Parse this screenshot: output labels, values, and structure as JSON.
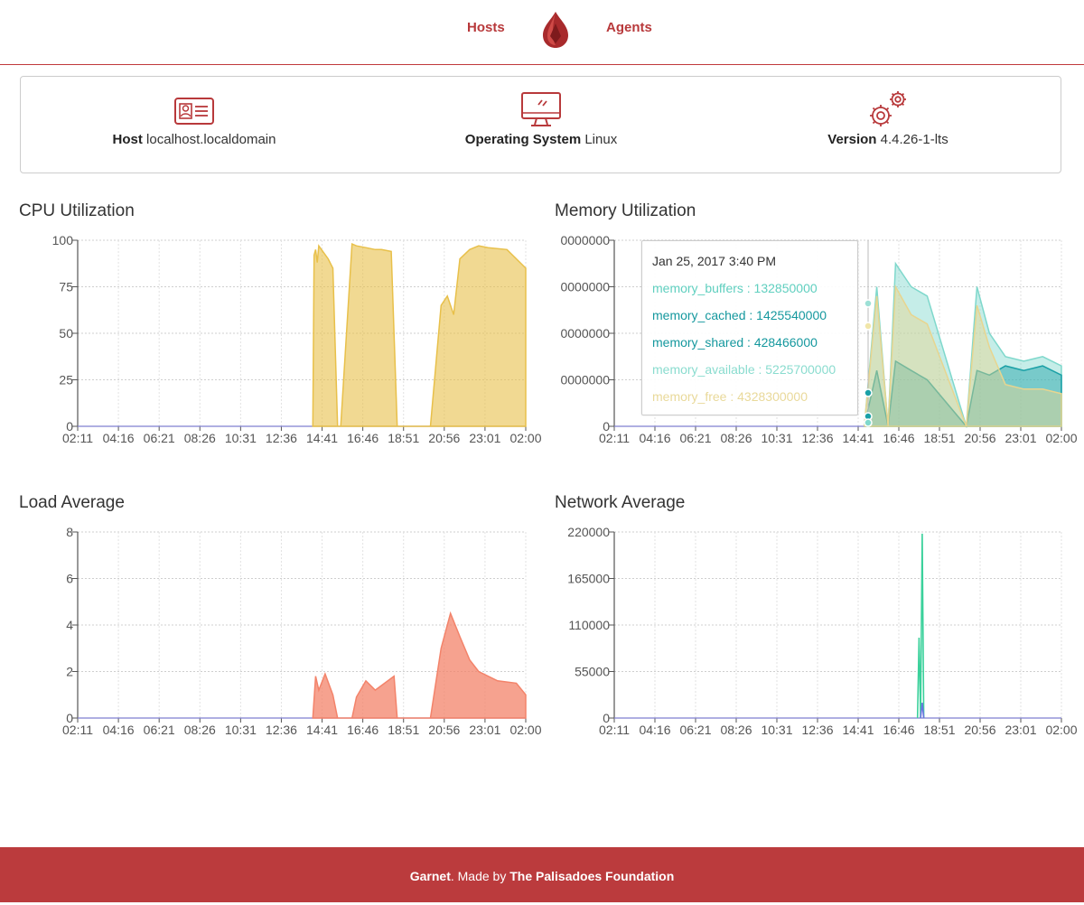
{
  "nav": {
    "hosts_label": "Hosts",
    "agents_label": "Agents",
    "logo_icon": "garnet-logo-icon"
  },
  "info": {
    "host": {
      "label": "Host",
      "value": "localhost.localdomain",
      "icon": "host-id-card-icon"
    },
    "os": {
      "label": "Operating System",
      "value": "Linux",
      "icon": "monitor-icon"
    },
    "version": {
      "label": "Version",
      "value": "4.4.26-1-lts",
      "icon": "gears-icon"
    }
  },
  "colors": {
    "brand": "#bb3b3d",
    "cpu": "#e8c04a",
    "load": "#f3836a",
    "mem_a": "#5ccfc0",
    "mem_b": "#1aa0a6",
    "net": "#3ad19b"
  },
  "chart_data": [
    {
      "type": "area",
      "title": "CPU Utilization",
      "x_ticks": [
        "02:11",
        "04:16",
        "06:21",
        "08:26",
        "10:31",
        "12:36",
        "14:41",
        "16:46",
        "18:51",
        "20:56",
        "23:01",
        "02:00"
      ],
      "y_ticks": [
        "0",
        "25",
        "50",
        "75",
        "100"
      ],
      "ylim": [
        0,
        100
      ],
      "grid": true,
      "series": [
        {
          "color": "#e8c04a",
          "x": [
            "14:41",
            "14:45",
            "14:50",
            "14:55",
            "15:00",
            "15:30",
            "15:45",
            "16:00",
            "16:10",
            "16:46",
            "17:00",
            "17:30",
            "18:00",
            "18:20",
            "18:51",
            "19:10",
            "20:56",
            "21:30",
            "21:50",
            "22:10",
            "22:30",
            "23:01",
            "23:30",
            "00:00",
            "01:00",
            "02:00"
          ],
          "values": [
            0,
            92,
            95,
            88,
            97,
            90,
            85,
            0,
            0,
            98,
            97,
            96,
            95,
            95,
            94,
            0,
            0,
            65,
            70,
            60,
            90,
            95,
            97,
            96,
            95,
            85
          ]
        }
      ]
    },
    {
      "type": "area",
      "title": "Memory Utilization",
      "x_ticks": [
        "02:11",
        "04:16",
        "06:21",
        "08:26",
        "10:31",
        "12:36",
        "14:41",
        "16:46",
        "18:51",
        "20:56",
        "23:01",
        "02:00"
      ],
      "y_ticks": [
        "0",
        "0000000",
        "0000000",
        "0000000",
        "0000000"
      ],
      "grid": true,
      "series": [
        {
          "name": "memory_buffers",
          "color": "#7fd8cc",
          "x": [
            "15:30",
            "16:10",
            "16:46",
            "17:10",
            "18:00",
            "18:51",
            "20:56",
            "21:30",
            "22:10",
            "23:01",
            "00:00",
            "01:00",
            "02:00"
          ],
          "values": [
            0,
            3,
            0,
            3.5,
            3.0,
            2.8,
            0,
            3.0,
            2.0,
            1.5,
            1.4,
            1.5,
            1.3
          ]
        },
        {
          "name": "memory_cached",
          "color": "#1aa0a6",
          "x": [
            "15:30",
            "16:10",
            "16:46",
            "17:10",
            "18:00",
            "18:51",
            "20:56",
            "21:30",
            "22:10",
            "23:01",
            "00:00",
            "01:00",
            "02:00"
          ],
          "values": [
            0,
            1.2,
            0,
            1.4,
            1.2,
            1.0,
            0,
            1.2,
            1.1,
            1.3,
            1.2,
            1.3,
            1.1
          ]
        },
        {
          "name": "memory_free",
          "color": "#e8d58f",
          "x": [
            "15:30",
            "16:10",
            "16:46",
            "17:10",
            "18:00",
            "18:51",
            "20:56",
            "21:30",
            "22:10",
            "23:01",
            "00:00",
            "01:00",
            "02:00"
          ],
          "values": [
            0,
            2.8,
            0,
            3.0,
            2.4,
            2.2,
            0,
            2.6,
            1.7,
            0.9,
            0.8,
            0.8,
            0.7
          ]
        }
      ],
      "tooltip": {
        "title": "Jan 25, 2017 3:40 PM",
        "rows": [
          {
            "label": "memory_buffers : 132850000",
            "color": "#5fcfbf"
          },
          {
            "label": "memory_cached : 1425540000",
            "color": "#15989e"
          },
          {
            "label": "memory_shared : 428466000",
            "color": "#15989e"
          },
          {
            "label": "memory_available : 5225700000",
            "color": "#8adccf"
          },
          {
            "label": "memory_free : 4328300000",
            "color": "#e9d99a"
          }
        ]
      }
    },
    {
      "type": "area",
      "title": "Load Average",
      "x_ticks": [
        "02:11",
        "04:16",
        "06:21",
        "08:26",
        "10:31",
        "12:36",
        "14:41",
        "16:46",
        "18:51",
        "20:56",
        "23:01",
        "02:00"
      ],
      "y_ticks": [
        "0",
        "2",
        "4",
        "6",
        "8"
      ],
      "ylim": [
        0,
        8
      ],
      "grid": true,
      "series": [
        {
          "color": "#f3836a",
          "x": [
            "14:41",
            "14:50",
            "15:00",
            "15:20",
            "15:45",
            "16:00",
            "16:46",
            "17:00",
            "17:30",
            "18:00",
            "18:30",
            "19:00",
            "19:10",
            "20:56",
            "21:30",
            "22:00",
            "22:30",
            "23:01",
            "23:30",
            "00:30",
            "01:30",
            "02:00"
          ],
          "values": [
            0,
            1.8,
            1.2,
            1.9,
            1.0,
            0,
            0,
            0.9,
            1.6,
            1.2,
            1.5,
            1.8,
            0,
            0,
            3.0,
            4.5,
            3.5,
            2.5,
            2.0,
            1.6,
            1.5,
            1.0
          ]
        }
      ]
    },
    {
      "type": "line",
      "title": "Network Average",
      "x_ticks": [
        "02:11",
        "04:16",
        "06:21",
        "08:26",
        "10:31",
        "12:36",
        "14:41",
        "16:46",
        "18:51",
        "20:56",
        "23:01",
        "02:00"
      ],
      "y_ticks": [
        "0",
        "55000",
        "110000",
        "165000",
        "220000"
      ],
      "ylim": [
        0,
        220000
      ],
      "grid": true,
      "series": [
        {
          "color": "#3ad19b",
          "x": [
            "18:20",
            "18:25",
            "18:30",
            "18:35",
            "18:40"
          ],
          "values": [
            0,
            95000,
            0,
            218000,
            0
          ]
        },
        {
          "color": "#6a73e0",
          "x": [
            "18:30",
            "18:35",
            "18:40"
          ],
          "values": [
            0,
            18000,
            0
          ]
        }
      ]
    }
  ],
  "footer": {
    "brand": "Garnet",
    "middle": ". Made by ",
    "org": "The Palisadoes Foundation"
  }
}
